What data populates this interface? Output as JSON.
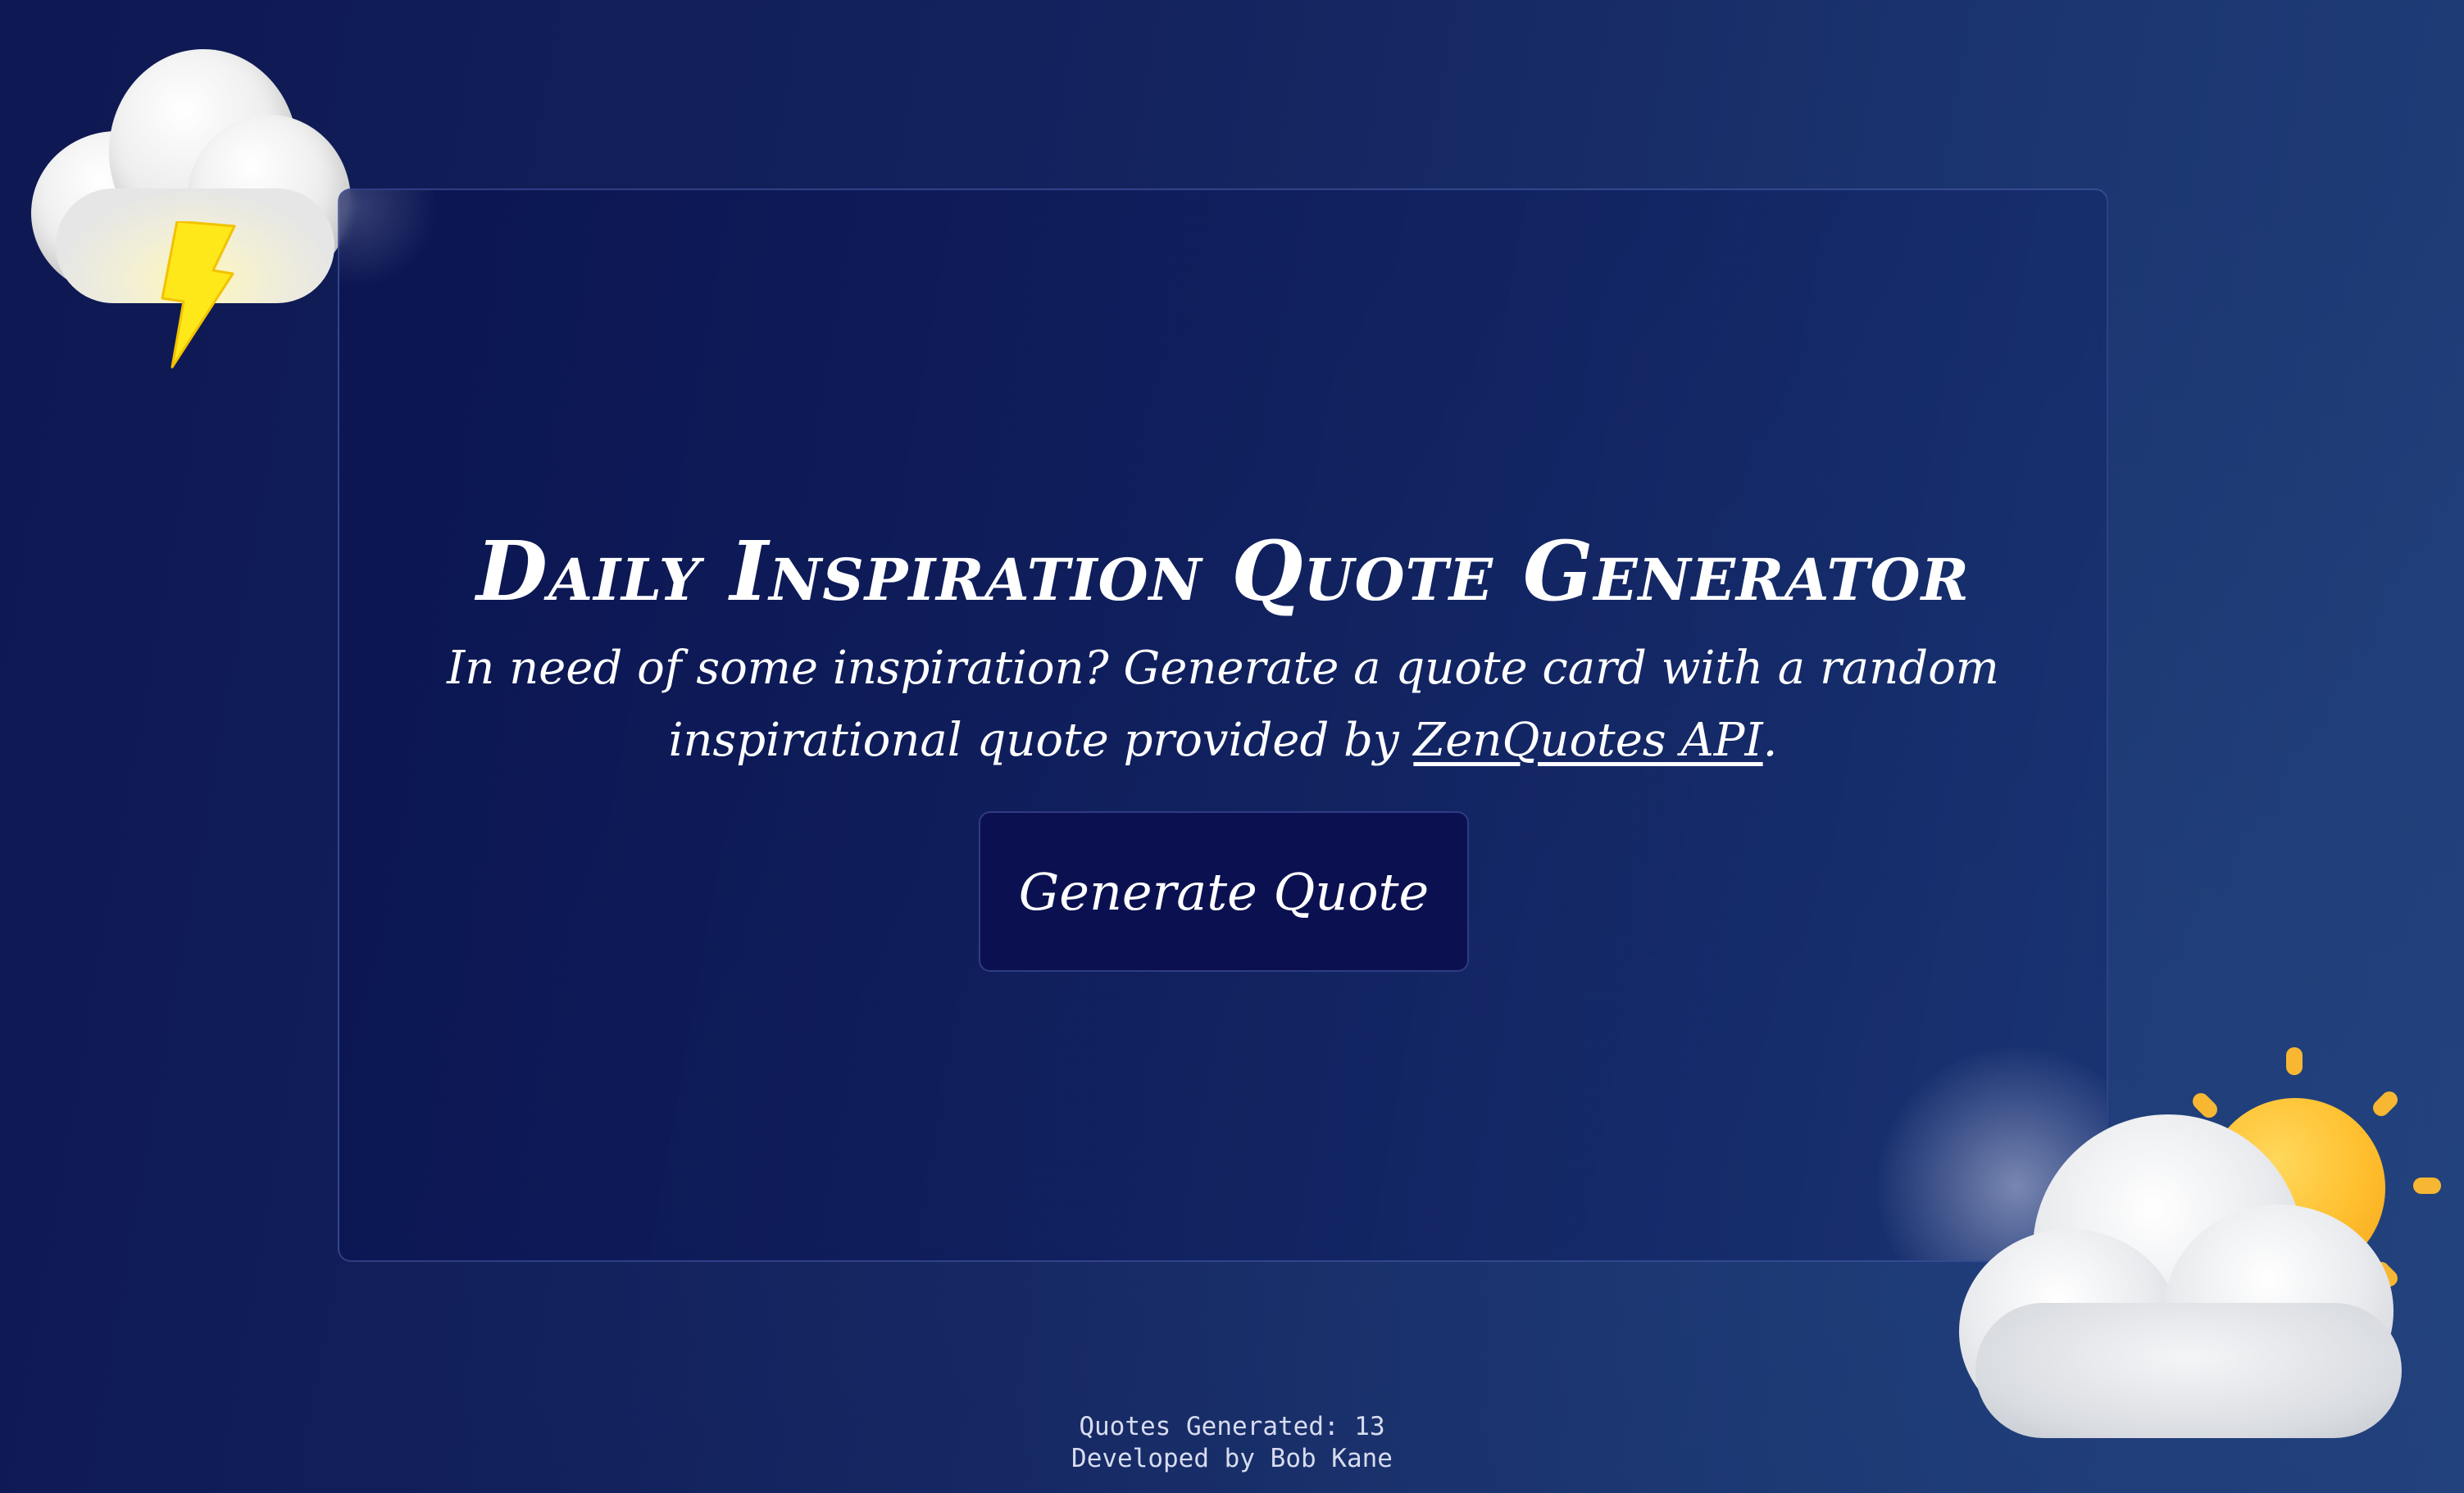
{
  "header": {
    "title": "Daily Inspiration Quote Generator",
    "description_prefix": "In need of some inspiration? Generate a quote card with a random inspirational quote provided by ",
    "api_link_label": "ZenQuotes API",
    "description_suffix": "."
  },
  "actions": {
    "generate_label": "Generate Quote"
  },
  "footer": {
    "quotes_generated": "Quotes Generated: 13",
    "developer": "Developed by Bob Kane"
  },
  "decorations": {
    "top_left": "storm-cloud-icon",
    "bottom_right": "sun-behind-cloud-icon"
  },
  "colors": {
    "background_start": "#0e1852",
    "background_end": "#213f7a",
    "button_bg": "#0b1150",
    "bolt": "#ffe81a",
    "sun": "#ffbf2e"
  }
}
